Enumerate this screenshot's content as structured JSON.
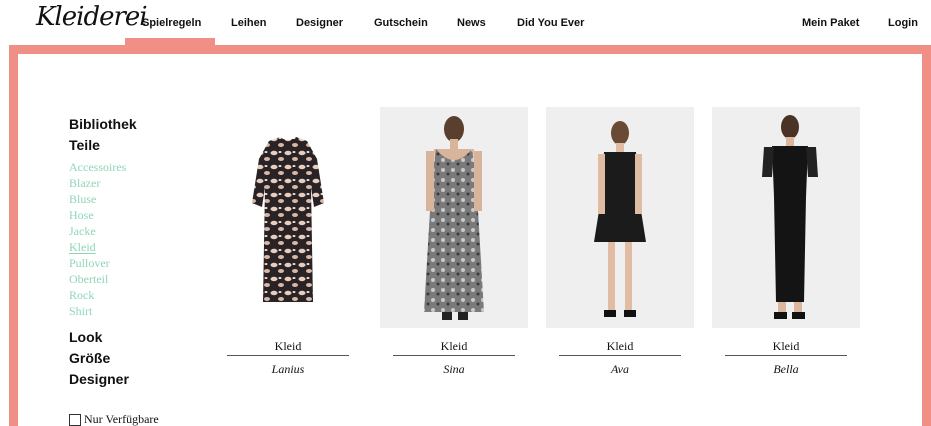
{
  "brand": {
    "logo": "Kleiderei"
  },
  "nav": {
    "items": [
      {
        "label": "Spielregeln",
        "active": true
      },
      {
        "label": "Leihen"
      },
      {
        "label": "Designer"
      },
      {
        "label": "Gutschein"
      },
      {
        "label": "News"
      },
      {
        "label": "Did You Ever"
      }
    ],
    "right": [
      {
        "label": "Mein Paket"
      },
      {
        "label": "Login"
      }
    ]
  },
  "colors": {
    "accent": "#f08f86",
    "category_link": "#8fd6b6"
  },
  "sidebar": {
    "bibliothek": "Bibliothek",
    "teile": "Teile",
    "categories": [
      "Accessoires",
      "Blazer",
      "Bluse",
      "Hose",
      "Jacke",
      "Kleid",
      "Pullover",
      "Oberteil",
      "Rock",
      "Shirt"
    ],
    "active_category": "Kleid",
    "look": "Look",
    "groesse": "Größe",
    "designer": "Designer",
    "filter_label": "Nur Verfügbare",
    "filter_checked": false
  },
  "products": [
    {
      "type": "Kleid",
      "name": "Lanius"
    },
    {
      "type": "Kleid",
      "name": "Sina"
    },
    {
      "type": "Kleid",
      "name": "Ava"
    },
    {
      "type": "Kleid",
      "name": "Bella"
    }
  ]
}
